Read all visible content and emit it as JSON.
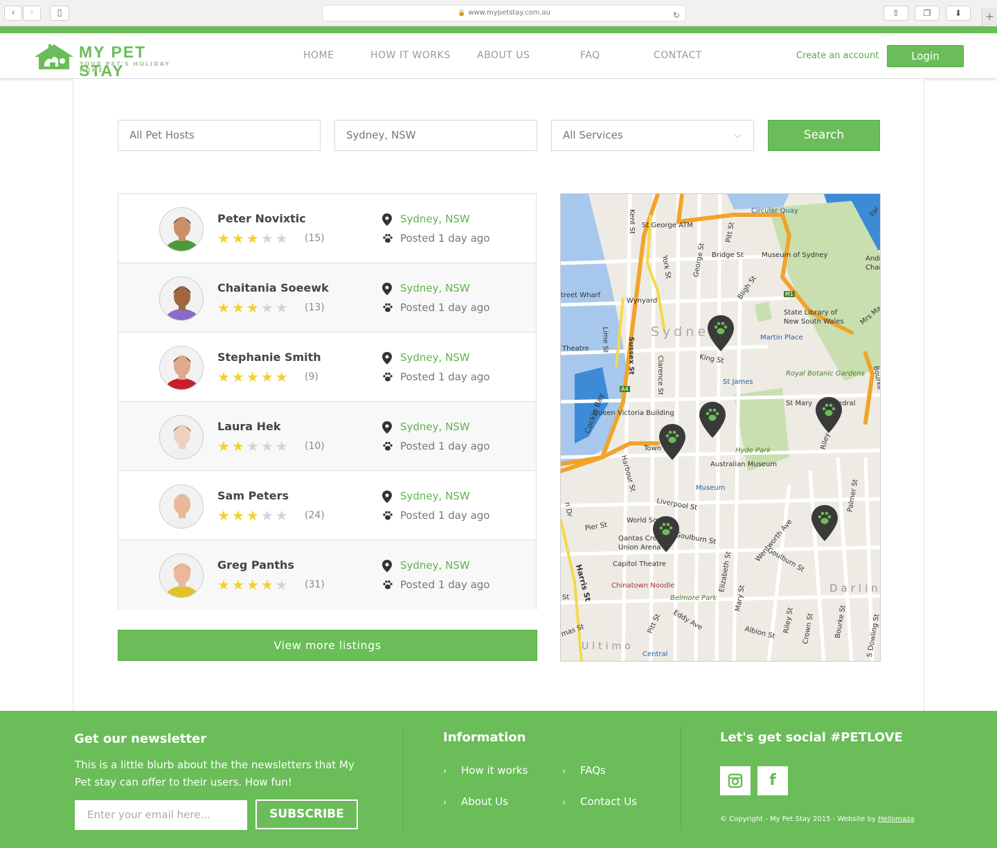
{
  "browser": {
    "url": "www.mypetstay.com.au"
  },
  "header": {
    "brand": "MY PET STAY",
    "tagline": "YOUR PET'S HOLIDAY HOME",
    "nav": [
      "HOME",
      "HOW IT WORKS",
      "ABOUT US",
      "FAQ",
      "CONTACT"
    ],
    "create_account": "Create an account",
    "login": "Login"
  },
  "search": {
    "host_placeholder": "All Pet Hosts",
    "location_value": "Sydney, NSW",
    "services_value": "All Services",
    "button": "Search"
  },
  "listings": [
    {
      "name": "Peter Noviχtic",
      "rating": 3,
      "reviews": "(15)",
      "location": "Sydney, NSW",
      "posted": "Posted 1 day ago"
    },
    {
      "name": "Chaitania Soeewk",
      "rating": 3,
      "reviews": "(13)",
      "location": "Sydney, NSW",
      "posted": "Posted 1 day ago"
    },
    {
      "name": "Stephanie Smith",
      "rating": 5,
      "reviews": "(9)",
      "location": "Sydney, NSW",
      "posted": "Posted 1 day ago"
    },
    {
      "name": "Laura Hek",
      "rating": 2,
      "reviews": "(10)",
      "location": "Sydney, NSW",
      "posted": "Posted 1 day ago"
    },
    {
      "name": "Sam Peters",
      "rating": 3,
      "reviews": "(24)",
      "location": "Sydney, NSW",
      "posted": "Posted 1 day ago"
    },
    {
      "name": "Greg Panths",
      "rating": 4,
      "reviews": "(31)",
      "location": "Sydney, NSW",
      "posted": "Posted 1 day ago"
    }
  ],
  "view_more": "View more listings",
  "map": {
    "labels": [
      "Circular Quay",
      "St George ATM",
      "Kent St",
      "Pitt St",
      "Bridge St",
      "Museum of Sydney",
      "George St",
      "York St",
      "Wynyard",
      "treet Wharf",
      "Bligh St",
      "M1",
      "State Library of",
      "New South Wales",
      "Mrs Ma",
      "Andr",
      "Char",
      "Far",
      "Sydney",
      "Martin Place",
      "King St",
      "Theatre",
      "Lime St",
      "Sussex St",
      "Clarence St",
      "St James",
      "Royal Botanic Gardens",
      "Bourke",
      "A4",
      "Cockle Bay",
      "Queen Victoria Building",
      "St Mary",
      "edral",
      "Town H",
      "Hyde Park",
      "Riley St",
      "Australian Museum",
      "Harbour St",
      "Museum",
      "Liverpool St",
      "Palmer St",
      "Pier St",
      "World Sq",
      "Qantas Cred",
      "Union Arena",
      "Goulburn St",
      "Wentworth Ave",
      "Goulburn St",
      "Capitol Theatre",
      "Elizabeth St",
      "Chinatown Noodle",
      "Belmore Park",
      "Mary St",
      "Darling",
      "Harris St",
      "Pitt St",
      "Eddy Ave",
      "Albion St",
      "Riley St",
      "Crown St",
      "Bourke St",
      "S Dowling St",
      "mas St",
      "Ultimo",
      "Central",
      "n Dr",
      "St"
    ],
    "marker_count": 6
  },
  "footer": {
    "newsletter_title": "Get our newsletter",
    "newsletter_blurb": "This is a little blurb about the the newsletters that My Pet stay can offer to their users. How fun!",
    "email_placeholder": "Enter your email here...",
    "subscribe": "SUBSCRIBE",
    "info_title": "Information",
    "links": [
      "How it works",
      "FAQs",
      "About Us",
      "Contact Us"
    ],
    "social_title": "Let's get social #PETLOVE",
    "copyright_prefix": "© Copyright - My Pet Stay 2015 - Website by ",
    "copyright_link": "Hellomaza"
  },
  "colors": {
    "brand_green": "#6abd58",
    "star": "#f5d029",
    "location_text": "#5cb44a",
    "marker": "#3a3a3a"
  }
}
